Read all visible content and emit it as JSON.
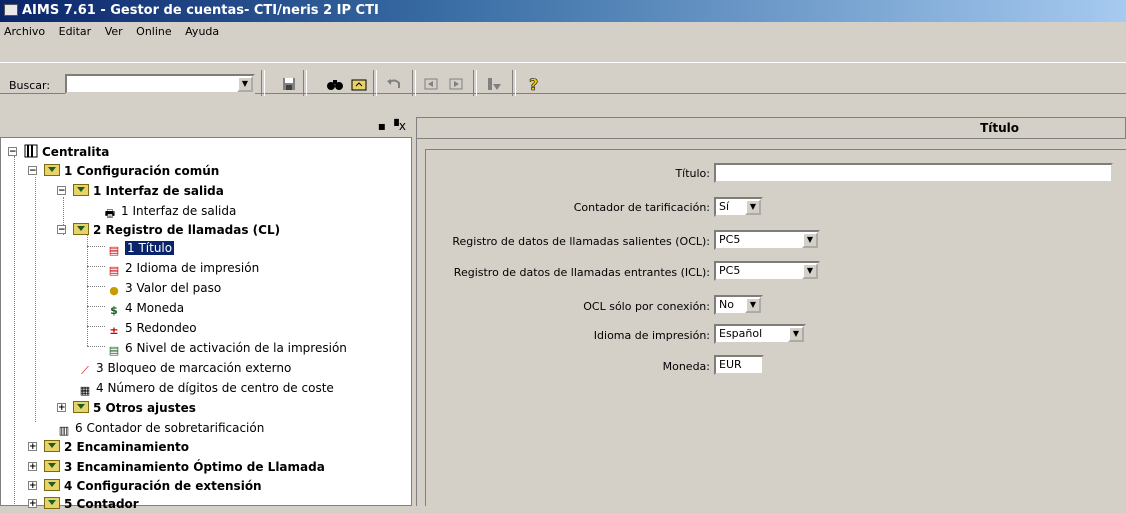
{
  "window": {
    "title": "AIMS 7.61  - Gestor de cuentas- CTI/neris 2 IP CTI"
  },
  "menu": {
    "items": [
      "Archivo",
      "Editar",
      "Ver",
      "Online",
      "Ayuda"
    ]
  },
  "toolbar": {
    "search_label": "Buscar:",
    "search_value": "",
    "buttons": [
      "save-icon",
      "find-icon",
      "folder-up-icon",
      "undo-icon",
      "back-icon",
      "forward-icon",
      "download-icon",
      "help-icon"
    ]
  },
  "left_pane": {
    "controls": "▪ ▝x"
  },
  "tree": {
    "root": "Centralita",
    "n1": "1 Configuración común",
    "n1_1": "1 Interfaz de salida",
    "n1_1_1": "1 Interfaz de salida",
    "n1_2": "2 Registro de llamadas (CL)",
    "n1_2_1": "1 Título",
    "n1_2_2": "2 Idioma de impresión",
    "n1_2_3": "3 Valor del paso",
    "n1_2_4": "4 Moneda",
    "n1_2_5": "5 Redondeo",
    "n1_2_6": "6 Nivel de activación de la impresión",
    "n1_3": "3 Bloqueo de marcación externo",
    "n1_4": "4 Número de dígitos de centro de coste",
    "n1_5": "5 Otros ajustes",
    "n1_6": "6 Contador de sobretarificación",
    "n2": "2 Encaminamiento",
    "n3": "3 Encaminamiento Óptimo de Llamada",
    "n4": "4 Configuración de extensión",
    "n5": "5 Contador"
  },
  "right_pane": {
    "header": "Título"
  },
  "form": {
    "titulo_label": "Título:",
    "titulo_value": "",
    "contador_label": "Contador de tarificación:",
    "contador_value": "Sí",
    "ocl_label": "Registro de datos de llamadas salientes (OCL):",
    "ocl_value": "PC5",
    "icl_label": "Registro de datos de llamadas entrantes (ICL):",
    "icl_value": "PC5",
    "ocl_conexion_label": "OCL sólo por conexión:",
    "ocl_conexion_value": "No",
    "idioma_label": "Idioma de impresión:",
    "idioma_value": "Español",
    "moneda_label": "Moneda:",
    "moneda_value": "EUR"
  }
}
